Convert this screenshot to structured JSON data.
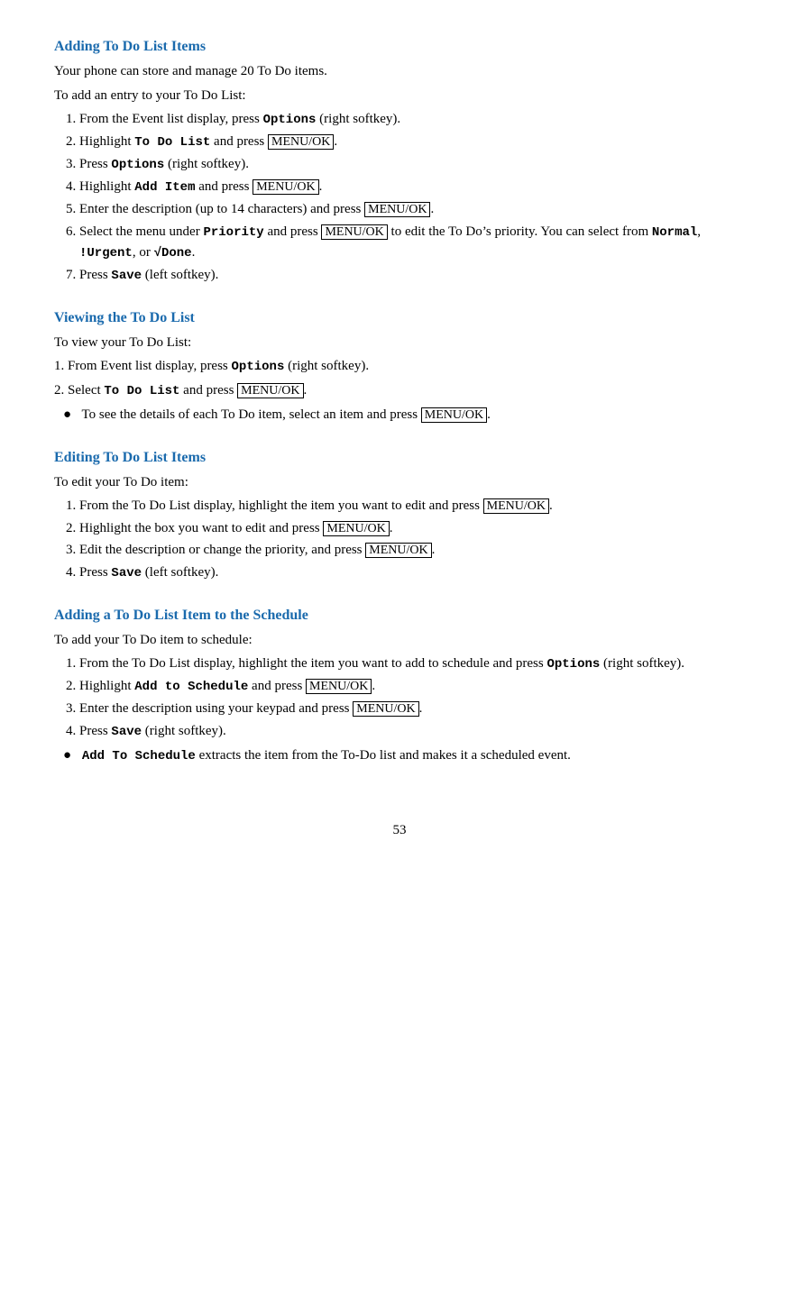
{
  "sections": [
    {
      "id": "adding-todo",
      "heading": "Adding To Do List Items",
      "intro": "Your phone can store and manage 20 To Do items.",
      "intro2": "To add an entry to your To Do List:",
      "steps": [
        {
          "text_parts": [
            {
              "text": "From the Event list display, press ",
              "type": "normal"
            },
            {
              "text": "Options",
              "type": "bold-fixed"
            },
            {
              "text": " (right softkey).",
              "type": "normal"
            }
          ]
        },
        {
          "text_parts": [
            {
              "text": "Highlight ",
              "type": "normal"
            },
            {
              "text": "To Do List",
              "type": "bold-fixed"
            },
            {
              "text": " and press ",
              "type": "normal"
            },
            {
              "text": "MENU/OK",
              "type": "kbd"
            },
            {
              "text": ".",
              "type": "normal"
            }
          ]
        },
        {
          "text_parts": [
            {
              "text": "Press ",
              "type": "normal"
            },
            {
              "text": "Options",
              "type": "bold-fixed"
            },
            {
              "text": " (right softkey).",
              "type": "normal"
            }
          ]
        },
        {
          "text_parts": [
            {
              "text": "Highlight ",
              "type": "normal"
            },
            {
              "text": "Add Item",
              "type": "bold-fixed"
            },
            {
              "text": " and press ",
              "type": "normal"
            },
            {
              "text": "MENU/OK",
              "type": "kbd"
            },
            {
              "text": ".",
              "type": "normal"
            }
          ]
        },
        {
          "text_parts": [
            {
              "text": "Enter the description (up to 14 characters) and press ",
              "type": "normal"
            },
            {
              "text": "MENU/OK",
              "type": "kbd"
            },
            {
              "text": ".",
              "type": "normal"
            }
          ]
        },
        {
          "text_parts": [
            {
              "text": "Select the menu under ",
              "type": "normal"
            },
            {
              "text": "Priority",
              "type": "bold-fixed"
            },
            {
              "text": " and press ",
              "type": "normal"
            },
            {
              "text": "MENU/OK",
              "type": "kbd"
            },
            {
              "text": " to edit the To Do’s priority. You can select from ",
              "type": "normal"
            },
            {
              "text": "Normal",
              "type": "bold-fixed"
            },
            {
              "text": ", ",
              "type": "normal"
            },
            {
              "text": "!Urgent",
              "type": "bold-fixed"
            },
            {
              "text": ", or ",
              "type": "normal"
            },
            {
              "text": "√Done",
              "type": "bold-fixed"
            },
            {
              "text": ".",
              "type": "normal"
            }
          ]
        },
        {
          "text_parts": [
            {
              "text": "Press ",
              "type": "normal"
            },
            {
              "text": "Save",
              "type": "bold-fixed"
            },
            {
              "text": " (left softkey).",
              "type": "normal"
            }
          ]
        }
      ]
    },
    {
      "id": "viewing-todo",
      "heading": "Viewing the To Do List",
      "intro": "To view your To Do List:",
      "numbered_steps_inline": [
        {
          "num": "1.",
          "text_parts": [
            {
              "text": "From Event list display, press ",
              "type": "normal"
            },
            {
              "text": "Options",
              "type": "bold-fixed"
            },
            {
              "text": " (right softkey).",
              "type": "normal"
            }
          ]
        },
        {
          "num": "2.",
          "text_parts": [
            {
              "text": "Select ",
              "type": "normal"
            },
            {
              "text": "To Do List",
              "type": "bold-fixed"
            },
            {
              "text": " and press ",
              "type": "normal"
            },
            {
              "text": "MENU/OK",
              "type": "kbd"
            },
            {
              "text": ".",
              "type": "normal"
            }
          ]
        }
      ],
      "bullets": [
        {
          "text_parts": [
            {
              "text": "To see the details of each To Do item, select an item and press ",
              "type": "normal"
            },
            {
              "text": "MENU/OK",
              "type": "kbd"
            },
            {
              "text": ".",
              "type": "normal"
            }
          ]
        }
      ]
    },
    {
      "id": "editing-todo",
      "heading": "Editing To Do List Items",
      "intro": "To edit your To Do item:",
      "steps": [
        {
          "text_parts": [
            {
              "text": "From the To Do List display, highlight the item you want to edit and press ",
              "type": "normal"
            },
            {
              "text": "MENU/OK",
              "type": "kbd"
            },
            {
              "text": ".",
              "type": "normal"
            }
          ]
        },
        {
          "text_parts": [
            {
              "text": "Highlight the box you want to edit and press ",
              "type": "normal"
            },
            {
              "text": "MENU/OK",
              "type": "kbd"
            },
            {
              "text": ".",
              "type": "normal"
            }
          ]
        },
        {
          "text_parts": [
            {
              "text": "Edit the description or change the priority, and press ",
              "type": "normal"
            },
            {
              "text": "MENU/OK",
              "type": "kbd"
            },
            {
              "text": ".",
              "type": "normal"
            }
          ]
        },
        {
          "text_parts": [
            {
              "text": "Press ",
              "type": "normal"
            },
            {
              "text": "Save",
              "type": "bold-fixed"
            },
            {
              "text": " (left softkey).",
              "type": "normal"
            }
          ]
        }
      ]
    },
    {
      "id": "adding-schedule",
      "heading": "Adding a To Do List Item to the Schedule",
      "intro": "To add your To Do item to schedule:",
      "steps": [
        {
          "text_parts": [
            {
              "text": "From the To Do List display, highlight the item you want to add to schedule and press ",
              "type": "normal"
            },
            {
              "text": "Options",
              "type": "bold-fixed"
            },
            {
              "text": " (right softkey).",
              "type": "normal"
            }
          ]
        },
        {
          "text_parts": [
            {
              "text": "Highlight ",
              "type": "normal"
            },
            {
              "text": "Add to Schedule",
              "type": "bold-fixed"
            },
            {
              "text": " and press ",
              "type": "normal"
            },
            {
              "text": "MENU/OK",
              "type": "kbd"
            },
            {
              "text": ".",
              "type": "normal"
            }
          ]
        },
        {
          "text_parts": [
            {
              "text": "Enter the description using your keypad and press ",
              "type": "normal"
            },
            {
              "text": "MENU/OK",
              "type": "kbd"
            },
            {
              "text": ".",
              "type": "normal"
            }
          ]
        },
        {
          "text_parts": [
            {
              "text": "Press ",
              "type": "normal"
            },
            {
              "text": "Save",
              "type": "bold-fixed"
            },
            {
              "text": " (right softkey).",
              "type": "normal"
            }
          ]
        }
      ],
      "bullets": [
        {
          "text_parts": [
            {
              "text": "Add To Schedule",
              "type": "bold-fixed"
            },
            {
              "text": " extracts the item from the To-Do list and makes it a scheduled event.",
              "type": "normal"
            }
          ]
        }
      ]
    }
  ],
  "page_number": "53"
}
